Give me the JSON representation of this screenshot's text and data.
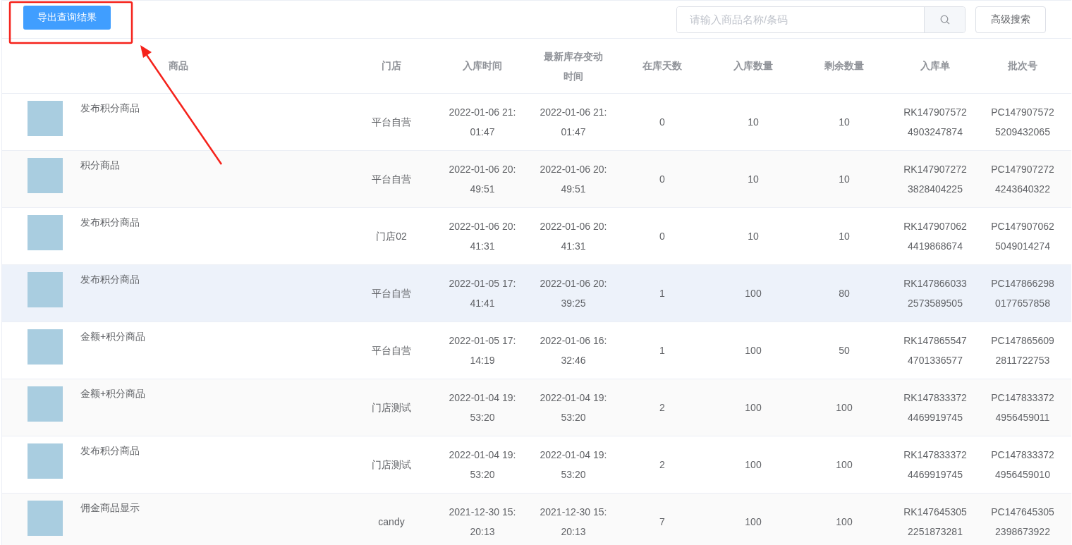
{
  "toolbar": {
    "export_button": "导出查询结果",
    "search": {
      "placeholder": "请输入商品名称/条码"
    },
    "advanced_button": "高级搜索"
  },
  "table": {
    "columns": [
      "商品",
      "门店",
      "入库时间",
      "最新库存变动时间",
      "在库天数",
      "入库数量",
      "剩余数量",
      "入库单",
      "批次号"
    ],
    "rows": [
      {
        "product": "发布积分商品",
        "store": "平台自营",
        "in_time": "2022-01-06 21:01:47",
        "update_time": "2022-01-06 21:01:47",
        "days": "0",
        "in_qty": "10",
        "remaining": "10",
        "receipt_no": "RK1479075724903247874",
        "batch_no": "PC1479075725209432065",
        "hovered": false
      },
      {
        "product": "积分商品",
        "store": "平台自营",
        "in_time": "2022-01-06 20:49:51",
        "update_time": "2022-01-06 20:49:51",
        "days": "0",
        "in_qty": "10",
        "remaining": "10",
        "receipt_no": "RK1479072723828404225",
        "batch_no": "PC1479072724243640322",
        "hovered": false
      },
      {
        "product": "发布积分商品",
        "store": "门店02",
        "in_time": "2022-01-06 20:41:31",
        "update_time": "2022-01-06 20:41:31",
        "days": "0",
        "in_qty": "10",
        "remaining": "10",
        "receipt_no": "RK1479070624419868674",
        "batch_no": "PC1479070625049014274",
        "hovered": false
      },
      {
        "product": "发布积分商品",
        "store": "平台自营",
        "in_time": "2022-01-05 17:41:41",
        "update_time": "2022-01-06 20:39:25",
        "days": "1",
        "in_qty": "100",
        "remaining": "80",
        "receipt_no": "RK1478660332573589505",
        "batch_no": "PC1478662980177657858",
        "hovered": true
      },
      {
        "product": "金额+积分商品",
        "store": "平台自营",
        "in_time": "2022-01-05 17:14:19",
        "update_time": "2022-01-06 16:32:46",
        "days": "1",
        "in_qty": "100",
        "remaining": "50",
        "receipt_no": "RK1478655474701336577",
        "batch_no": "PC1478656092811722753",
        "hovered": false
      },
      {
        "product": "金额+积分商品",
        "store": "门店测试",
        "in_time": "2022-01-04 19:53:20",
        "update_time": "2022-01-04 19:53:20",
        "days": "2",
        "in_qty": "100",
        "remaining": "100",
        "receipt_no": "RK1478333724469919745",
        "batch_no": "PC1478333724956459011",
        "hovered": false
      },
      {
        "product": "发布积分商品",
        "store": "门店测试",
        "in_time": "2022-01-04 19:53:20",
        "update_time": "2022-01-04 19:53:20",
        "days": "2",
        "in_qty": "100",
        "remaining": "100",
        "receipt_no": "RK1478333724469919745",
        "batch_no": "PC1478333724956459010",
        "hovered": false
      },
      {
        "product": "佣金商品显示",
        "store": "candy",
        "in_time": "2021-12-30 15:20:13",
        "update_time": "2021-12-30 15:20:13",
        "days": "7",
        "in_qty": "100",
        "remaining": "100",
        "receipt_no": "RK1476453052251873281",
        "batch_no": "PC1476453052398673922",
        "hovered": false
      }
    ]
  }
}
